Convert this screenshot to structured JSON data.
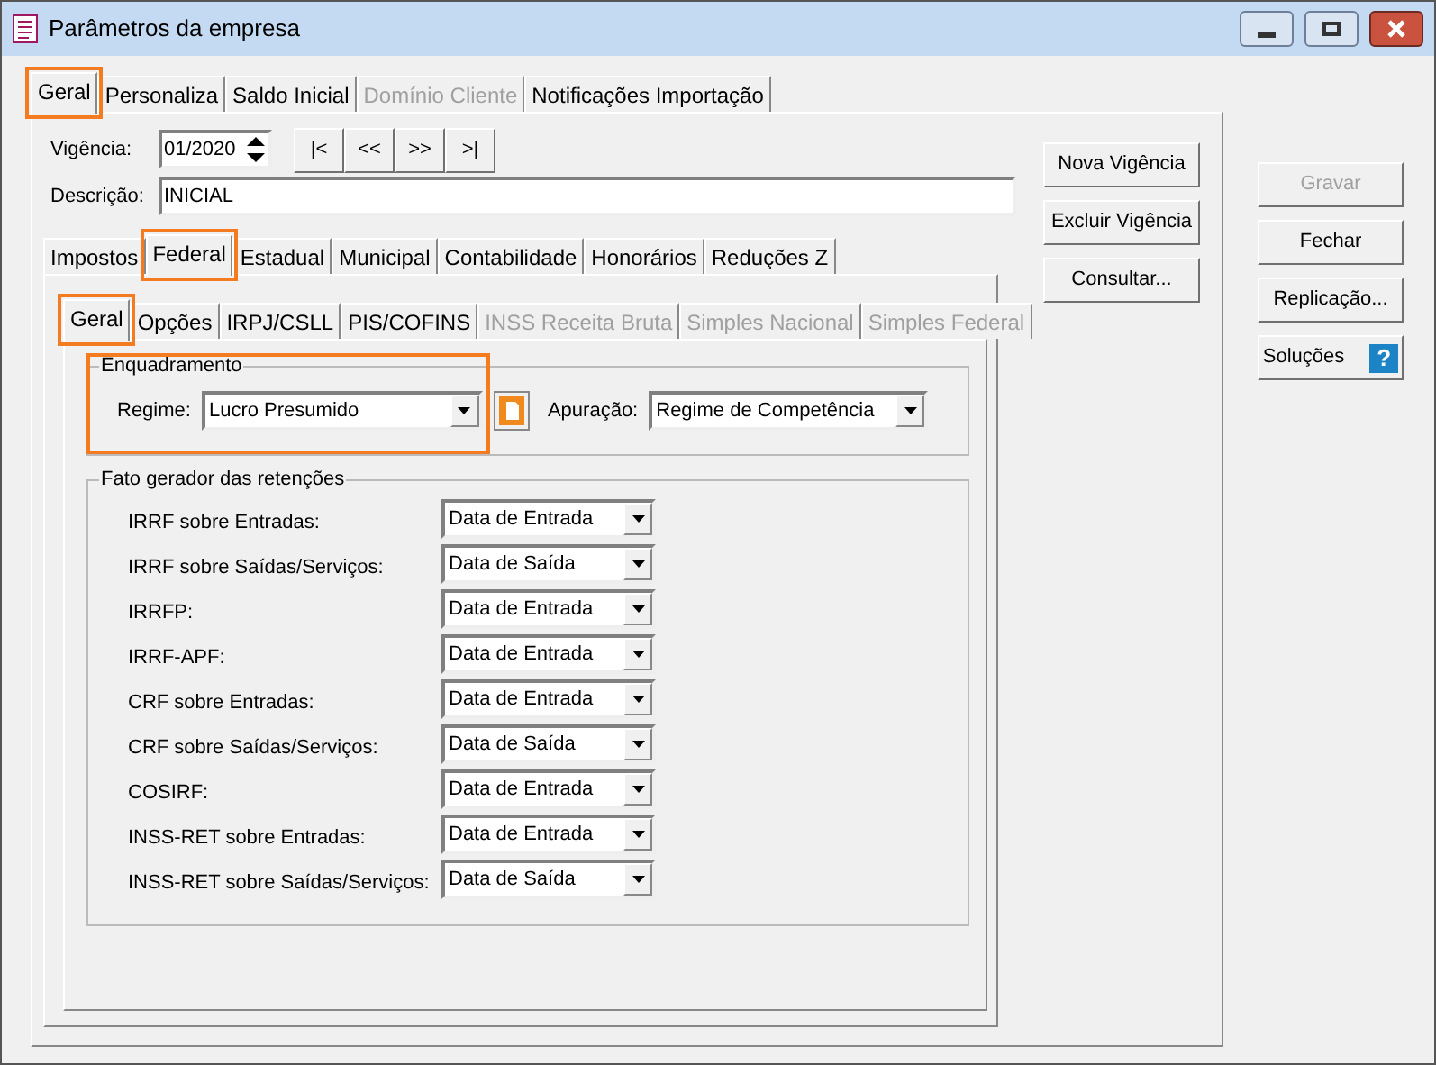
{
  "window": {
    "title": "Parâmetros da empresa"
  },
  "tabs": [
    {
      "label": "Geral",
      "selected": true,
      "disabled": false,
      "highlighted": true
    },
    {
      "label": "Personaliza",
      "selected": false,
      "disabled": false,
      "highlighted": false
    },
    {
      "label": "Saldo Inicial",
      "selected": false,
      "disabled": false,
      "highlighted": false
    },
    {
      "label": "Domínio Cliente",
      "selected": false,
      "disabled": true,
      "highlighted": false
    },
    {
      "label": "Notificações Importação",
      "selected": false,
      "disabled": false,
      "highlighted": false
    }
  ],
  "vigencia": {
    "label": "Vigência:",
    "value": "01/2020"
  },
  "nav_buttons": [
    "|<",
    "<<",
    ">>",
    ">|"
  ],
  "descricao": {
    "label": "Descrição:",
    "value": "INICIAL"
  },
  "panel_buttons": [
    "Nova Vigência",
    "Excluir Vigência",
    "Consultar..."
  ],
  "tax_tabs": [
    {
      "label": "Impostos",
      "selected": false,
      "disabled": false,
      "highlighted": false
    },
    {
      "label": "Federal",
      "selected": true,
      "disabled": false,
      "highlighted": true
    },
    {
      "label": "Estadual",
      "selected": false,
      "disabled": false,
      "highlighted": false
    },
    {
      "label": "Municipal",
      "selected": false,
      "disabled": false,
      "highlighted": false
    },
    {
      "label": "Contabilidade",
      "selected": false,
      "disabled": false,
      "highlighted": false
    },
    {
      "label": "Honorários",
      "selected": false,
      "disabled": false,
      "highlighted": false
    },
    {
      "label": "Reduções Z",
      "selected": false,
      "disabled": false,
      "highlighted": false
    }
  ],
  "federal_tabs": [
    {
      "label": "Geral",
      "selected": true,
      "disabled": false,
      "highlighted": true
    },
    {
      "label": "Opções",
      "selected": false,
      "disabled": false,
      "highlighted": false
    },
    {
      "label": "IRPJ/CSLL",
      "selected": false,
      "disabled": false,
      "highlighted": false
    },
    {
      "label": "PIS/COFINS",
      "selected": false,
      "disabled": false,
      "highlighted": false
    },
    {
      "label": "INSS Receita Bruta",
      "selected": false,
      "disabled": true,
      "highlighted": false
    },
    {
      "label": "Simples Nacional",
      "selected": false,
      "disabled": true,
      "highlighted": false
    },
    {
      "label": "Simples Federal",
      "selected": false,
      "disabled": true,
      "highlighted": false
    }
  ],
  "enquadramento": {
    "title": "Enquadramento",
    "highlighted": true,
    "regime": {
      "label": "Regime:",
      "value": "Lucro Presumido"
    },
    "apuracao": {
      "label": "Apuração:",
      "value": "Regime de Competência"
    }
  },
  "fato_gerador": {
    "title": "Fato gerador das retenções",
    "rows": [
      {
        "label": "IRRF sobre Entradas:",
        "value": "Data de Entrada"
      },
      {
        "label": "IRRF sobre Saídas/Serviços:",
        "value": "Data de Saída"
      },
      {
        "label": "IRRFP:",
        "value": "Data de Entrada"
      },
      {
        "label": "IRRF-APF:",
        "value": "Data de Entrada"
      },
      {
        "label": "CRF sobre Entradas:",
        "value": "Data de Entrada"
      },
      {
        "label": "CRF sobre Saídas/Serviços:",
        "value": "Data de Saída"
      },
      {
        "label": "COSIRF:",
        "value": "Data de Entrada"
      },
      {
        "label": "INSS-RET sobre Entradas:",
        "value": "Data de Entrada"
      },
      {
        "label": "INSS-RET sobre Saídas/Serviços:",
        "value": "Data de Saída"
      }
    ]
  },
  "side_buttons": [
    {
      "label": "Gravar",
      "disabled": true,
      "kind": "plain"
    },
    {
      "label": "Fechar",
      "disabled": false,
      "kind": "plain"
    },
    {
      "label": "Replicação...",
      "disabled": false,
      "kind": "plain"
    },
    {
      "label": "Soluções",
      "disabled": false,
      "kind": "help",
      "icon": "?"
    }
  ]
}
